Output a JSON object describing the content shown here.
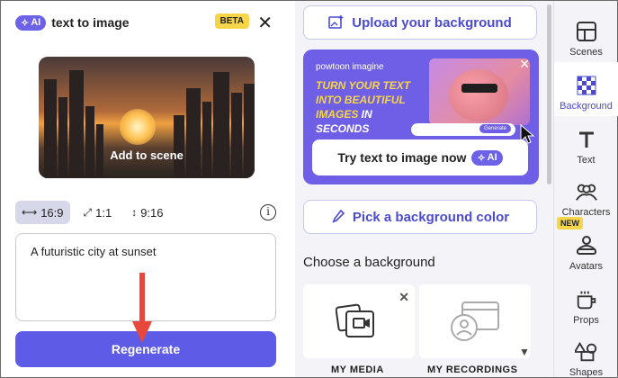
{
  "left_panel": {
    "ai_chip": "AI",
    "title": "text to image",
    "beta": "BETA",
    "close": "✕",
    "preview_action": "Add to scene",
    "ratios": [
      "16:9",
      "1:1",
      "9:16"
    ],
    "active_ratio": "16:9",
    "prompt": "A futuristic city at sunset",
    "regenerate_label": "Regenerate"
  },
  "middle_panel": {
    "upload_label": "Upload your background",
    "promo": {
      "brand": "powtoon imagine",
      "line1": "TURN YOUR TEXT",
      "line2": "INTO BEAUTIFUL",
      "line3_a": "IMAGES",
      "line3_b": " IN",
      "line4": "SECONDS",
      "generate_label": "Generate",
      "cta_label": "Try text to image now",
      "cta_chip": "AI"
    },
    "color_label": "Pick a background color",
    "section_title": "Choose a background",
    "tiles": [
      {
        "label": "MY MEDIA"
      },
      {
        "label": "MY RECORDINGS"
      }
    ]
  },
  "sidebar": {
    "items": [
      {
        "label": "Scenes",
        "icon": "scenes-icon"
      },
      {
        "label": "Background",
        "icon": "background-icon",
        "active": true
      },
      {
        "label": "Text",
        "icon": "text-icon"
      },
      {
        "label": "Characters",
        "icon": "characters-icon"
      },
      {
        "label": "Avatars",
        "icon": "avatars-icon",
        "badge": "NEW"
      },
      {
        "label": "Props",
        "icon": "props-icon"
      },
      {
        "label": "Shapes",
        "icon": "shapes-icon"
      }
    ]
  },
  "colors": {
    "accent": "#5e5ce6",
    "promo_bg": "#6f5fe6",
    "badge_yellow": "#f6d548",
    "arrow_red": "#e8473b"
  }
}
